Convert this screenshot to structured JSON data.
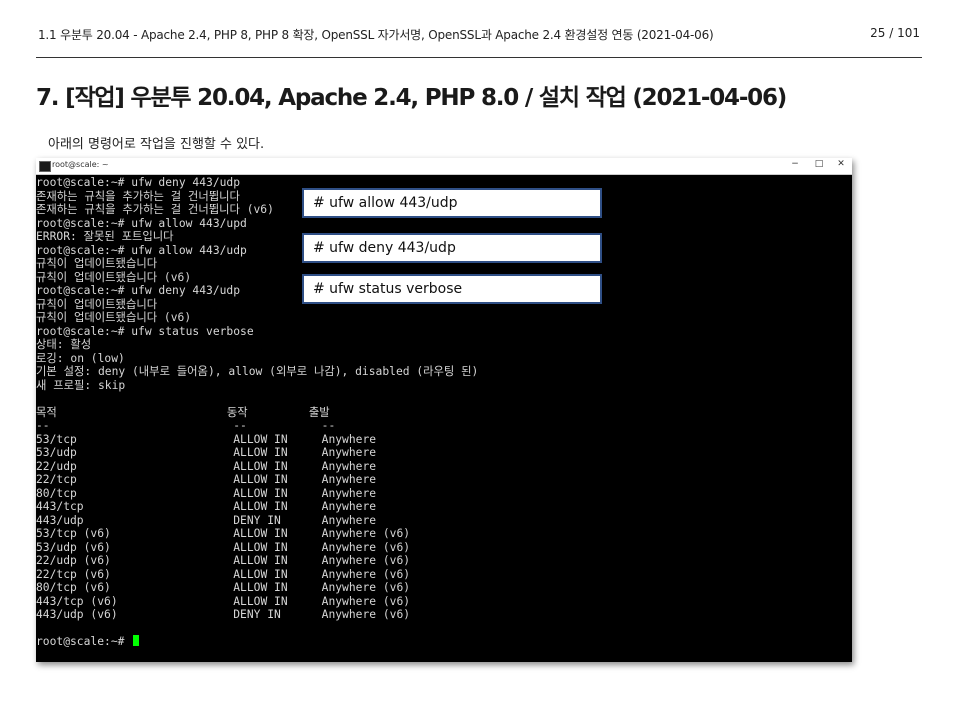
{
  "header": {
    "doc_title": "1.1 우분투 20.04 - Apache 2.4, PHP 8, PHP 8 확장, OpenSSL 자가서명, OpenSSL과 Apache 2.4 환경설정 연동 (2021-04-06)",
    "page": "25 / 101"
  },
  "section_title": "7. [작업] 우분투 20.04, Apache 2.4, PHP 8.0 / 설치 작업 (2021-04-06)",
  "intro": "아래의 명령어로 작업을 진행할 수 있다.",
  "window": {
    "title": "root@scale: ~",
    "minimize": "−",
    "maximize": "□",
    "close": "✕"
  },
  "terminal": {
    "lines": [
      "root@scale:~# ufw deny 443/udp",
      "존재하는 규칙을 추가하는 걸 건너뜁니다",
      "존재하는 규칙을 추가하는 걸 건너뜁니다 (v6)",
      "root@scale:~# ufw allow 443/upd",
      "ERROR: 잘못된 포트입니다",
      "root@scale:~# ufw allow 443/udp",
      "규칙이 업데이트됐습니다",
      "규칙이 업데이트됐습니다 (v6)",
      "root@scale:~# ufw deny 443/udp",
      "규칙이 업데이트됐습니다",
      "규칙이 업데이트됐습니다 (v6)",
      "root@scale:~# ufw status verbose",
      "상태: 활성",
      "로깅: on (low)",
      "기본 설정: deny (내부로 들어옴), allow (외부로 나감), disabled (라우팅 된)",
      "새 프로필: skip",
      "",
      "목적                         동작         출발",
      "--                           --           --",
      "53/tcp                       ALLOW IN     Anywhere",
      "53/udp                       ALLOW IN     Anywhere",
      "22/udp                       ALLOW IN     Anywhere",
      "22/tcp                       ALLOW IN     Anywhere",
      "80/tcp                       ALLOW IN     Anywhere",
      "443/tcp                      ALLOW IN     Anywhere",
      "443/udp                      DENY IN      Anywhere",
      "53/tcp (v6)                  ALLOW IN     Anywhere (v6)",
      "53/udp (v6)                  ALLOW IN     Anywhere (v6)",
      "22/udp (v6)                  ALLOW IN     Anywhere (v6)",
      "22/tcp (v6)                  ALLOW IN     Anywhere (v6)",
      "80/tcp (v6)                  ALLOW IN     Anywhere (v6)",
      "443/tcp (v6)                 ALLOW IN     Anywhere (v6)",
      "443/udp (v6)                 DENY IN      Anywhere (v6)",
      ""
    ],
    "prompt": "root@scale:~# "
  },
  "callouts": [
    "# ufw allow 443/udp",
    "# ufw deny 443/udp",
    "# ufw status verbose"
  ]
}
